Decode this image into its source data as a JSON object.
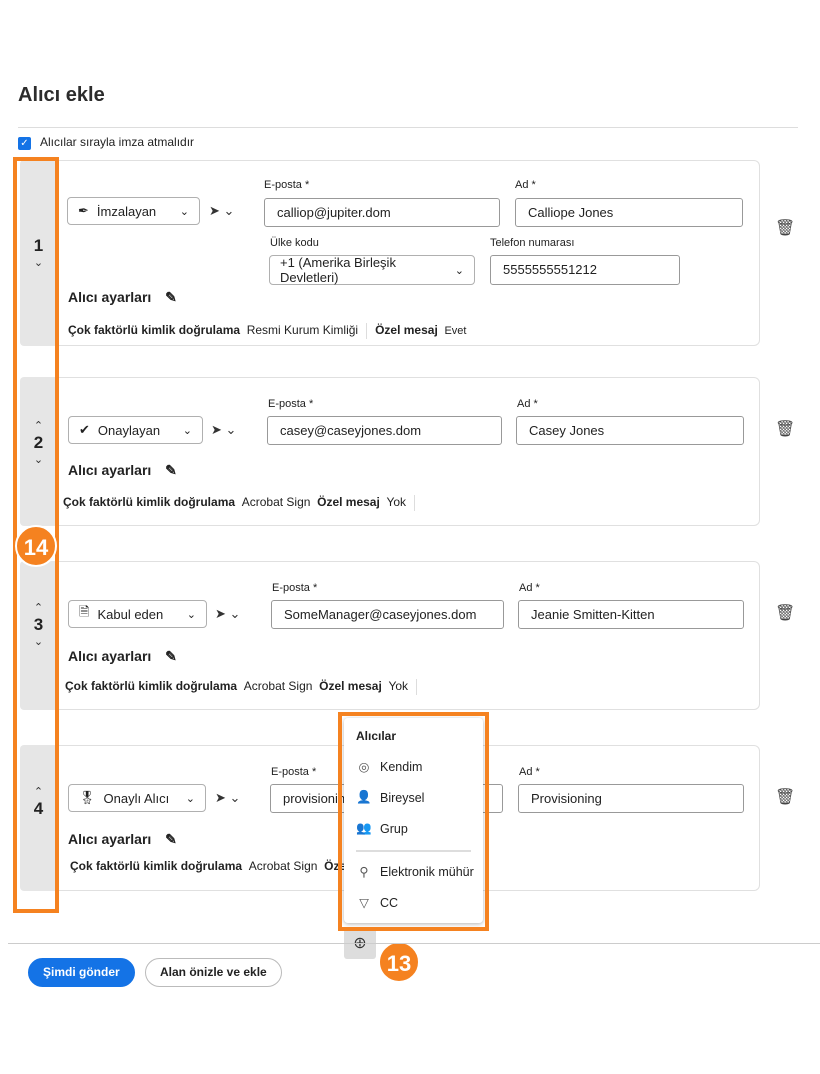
{
  "title": "Alıcı ekle",
  "sequential": {
    "label": "Alıcılar sırayla imza atmalıdır",
    "checked": true
  },
  "labels": {
    "email": "E-posta",
    "name": "Ad",
    "required": "*",
    "country": "Ülke kodu",
    "phone": "Telefon numarası",
    "settings": "Alıcı ayarları",
    "mfa": "Çok faktörlü kimlik doğrulama",
    "custom_msg": "Özel mesaj"
  },
  "recipients": [
    {
      "order": "1",
      "role": "İmzalayan",
      "email": "calliop@jupiter.dom",
      "name": "Calliope Jones",
      "country": "+1 (Amerika Birleşik Devletleri)",
      "phone": "5555555551212",
      "mfa": "Resmi Kurum Kimliği",
      "message": "Evet"
    },
    {
      "order": "2",
      "role": "Onaylayan",
      "email": "casey@caseyjones.dom",
      "name": "Casey Jones",
      "mfa": "Acrobat Sign",
      "message": "Yok"
    },
    {
      "order": "3",
      "role": "Kabul eden",
      "email": "SomeManager@caseyjones.dom",
      "name": "Jeanie Smitten-Kitten",
      "mfa": "Acrobat Sign",
      "message": "Yok"
    },
    {
      "order": "4",
      "role": "Onaylı Alıcı",
      "email": "provisionin",
      "name": "Provisioning",
      "mfa": "Acrobat Sign",
      "message": "Öze"
    }
  ],
  "menu": {
    "header": "Alıcılar",
    "items": [
      "Kendim",
      "Bireysel",
      "Grup",
      "Elektronik mühür",
      "CC"
    ]
  },
  "callouts": [
    "14",
    "13"
  ],
  "footer": {
    "send": "Şimdi gönder",
    "preview": "Alan önizle ve ekle"
  },
  "colors": {
    "accent": "#1473e6",
    "callout": "#f58220"
  }
}
